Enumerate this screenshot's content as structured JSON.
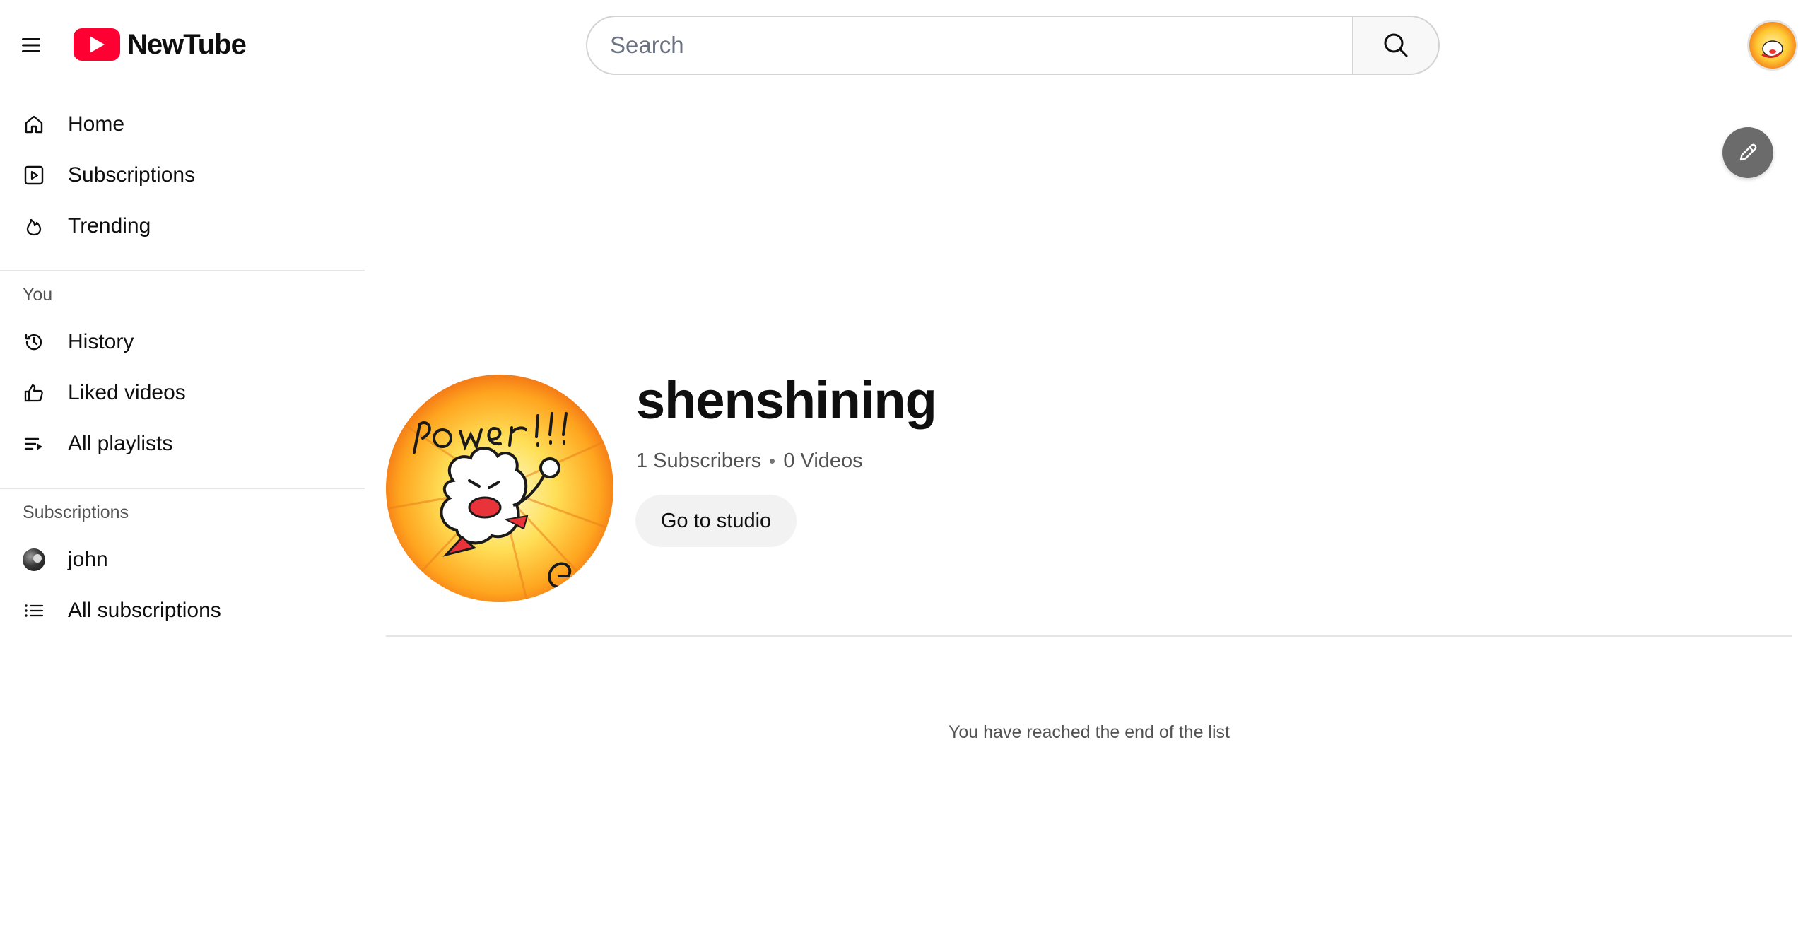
{
  "header": {
    "logo_text": "NewTube",
    "search_placeholder": "Search"
  },
  "sidebar": {
    "main_items": [
      {
        "label": "Home",
        "icon": "home-icon"
      },
      {
        "label": "Subscriptions",
        "icon": "subscriptions-icon"
      },
      {
        "label": "Trending",
        "icon": "flame-icon"
      }
    ],
    "you_heading": "You",
    "you_items": [
      {
        "label": "History",
        "icon": "history-icon"
      },
      {
        "label": "Liked videos",
        "icon": "thumbs-up-icon"
      },
      {
        "label": "All playlists",
        "icon": "playlist-icon"
      }
    ],
    "subscriptions_heading": "Subscriptions",
    "subscription_items": [
      {
        "label": "john",
        "icon": "avatar"
      },
      {
        "label": "All subscriptions",
        "icon": "list-icon"
      }
    ]
  },
  "channel": {
    "name": "shenshining",
    "subscribers": "1 Subscribers",
    "videos": "0 Videos",
    "studio_button": "Go to studio",
    "avatar_text": "Power!!!"
  },
  "end_of_list": "You have reached the end of the list",
  "colors": {
    "brand": "#ff0033",
    "edit_button": "#6b6b6b",
    "divider": "#e5e5e5"
  }
}
